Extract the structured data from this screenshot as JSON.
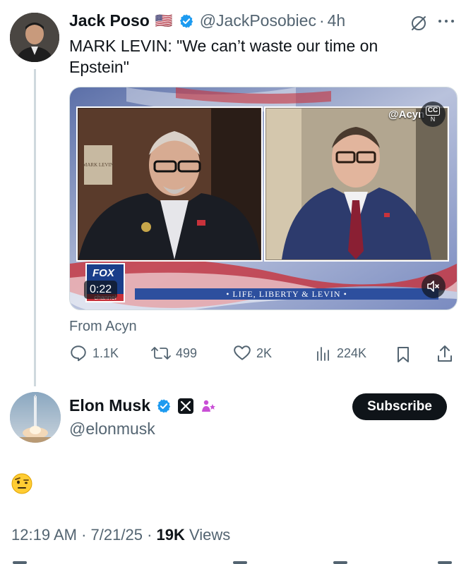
{
  "tweet1": {
    "author_name": "Jack Poso",
    "author_flag": "🇺🇸",
    "handle": "@JackPosobiec",
    "separator": "·",
    "time": "4h",
    "text": "MARK LEVIN: \"We can’t waste our time on Epstein\"",
    "video": {
      "watermark": "@Acyn",
      "cc_label": "CC",
      "cc_sub": "N",
      "duration": "0:22",
      "banner": "• LIFE, LIBERTY & LEVIN •",
      "network_top": "FOX",
      "network_bottom": "channel",
      "book_text": "MARK LEVIN ON POWER"
    },
    "from_text": "From Acyn",
    "actions": {
      "replies": "1.1K",
      "reposts": "499",
      "likes": "2K",
      "views": "224K"
    }
  },
  "tweet2": {
    "author_name": "Elon Musk",
    "handle": "@elonmusk",
    "subscribe_label": "Subscribe",
    "emoji": "🤨",
    "time": "12:19 AM",
    "date": "7/21/25",
    "separator": "·",
    "views_count": "19K",
    "views_label": "Views"
  },
  "colors": {
    "verified_blue": "#1d9bf0",
    "text_primary": "#0f1419",
    "text_muted": "#536471",
    "thread_line": "#cfd9de"
  }
}
